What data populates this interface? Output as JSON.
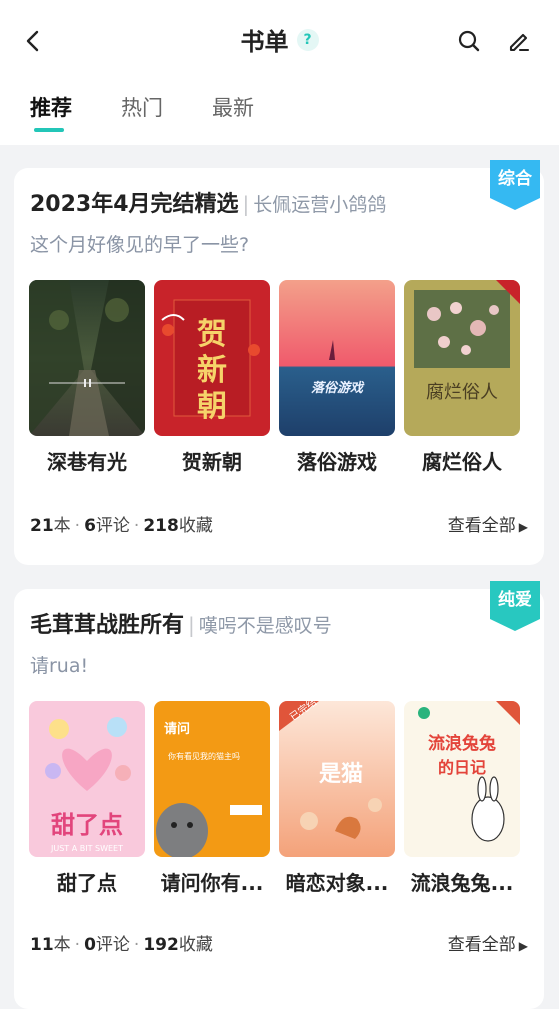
{
  "header": {
    "title": "书单",
    "help": "?"
  },
  "tabs": [
    {
      "label": "推荐",
      "active": true
    },
    {
      "label": "热门",
      "active": false
    },
    {
      "label": "最新",
      "active": false
    }
  ],
  "colors": {
    "accent": "#23c6b8",
    "ribbon_blue": "#35b9f2",
    "ribbon_teal": "#28c8c0"
  },
  "cards": [
    {
      "tag": "综合",
      "title": "2023年4月完结精选",
      "author": "长佩运营小鸽鸽",
      "subtitle": "这个月好像见的早了一些?",
      "books": [
        {
          "title": "深巷有光"
        },
        {
          "title": "贺新朝",
          "cover_text": "贺新朝"
        },
        {
          "title": "落俗游戏",
          "cover_text": "落俗游戏"
        },
        {
          "title": "腐烂俗人",
          "cover_text": "腐烂俗人"
        }
      ],
      "stats": {
        "books": "21",
        "books_unit": "本",
        "comments": "6",
        "comments_unit": "评论",
        "favorites": "218",
        "favorites_unit": "收藏"
      },
      "view_all": "查看全部"
    },
    {
      "tag": "纯爱",
      "title": "毛茸茸战胜所有",
      "author": "嘆呺不是感叹号",
      "subtitle": "请rua!",
      "books": [
        {
          "title": "甜了点",
          "cover_text": "甜了点",
          "cover_sub": "JUST A BIT SWEET"
        },
        {
          "title": "请问你有...",
          "cover_text": "请问",
          "cover_sub": "你有看见我的猫主吗"
        },
        {
          "title": "暗恋对象...",
          "cover_text": "是猫",
          "cover_badge": "已完结"
        },
        {
          "title": "流浪兔兔...",
          "cover_text": "流浪兔兔的日记"
        }
      ],
      "stats": {
        "books": "11",
        "books_unit": "本",
        "comments": "0",
        "comments_unit": "评论",
        "favorites": "192",
        "favorites_unit": "收藏"
      },
      "view_all": "查看全部"
    }
  ]
}
